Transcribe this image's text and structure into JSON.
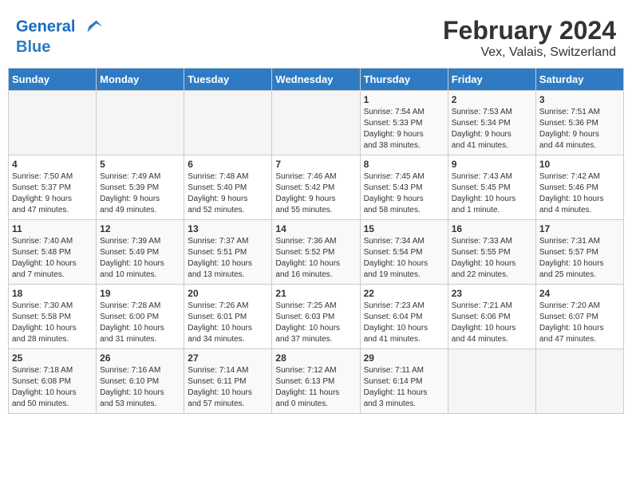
{
  "header": {
    "logo_general": "General",
    "logo_blue": "Blue",
    "title": "February 2024",
    "subtitle": "Vex, Valais, Switzerland"
  },
  "weekdays": [
    "Sunday",
    "Monday",
    "Tuesday",
    "Wednesday",
    "Thursday",
    "Friday",
    "Saturday"
  ],
  "weeks": [
    [
      {
        "day": null,
        "info": null
      },
      {
        "day": null,
        "info": null
      },
      {
        "day": null,
        "info": null
      },
      {
        "day": null,
        "info": null
      },
      {
        "day": "1",
        "info": "Sunrise: 7:54 AM\nSunset: 5:33 PM\nDaylight: 9 hours\nand 38 minutes."
      },
      {
        "day": "2",
        "info": "Sunrise: 7:53 AM\nSunset: 5:34 PM\nDaylight: 9 hours\nand 41 minutes."
      },
      {
        "day": "3",
        "info": "Sunrise: 7:51 AM\nSunset: 5:36 PM\nDaylight: 9 hours\nand 44 minutes."
      }
    ],
    [
      {
        "day": "4",
        "info": "Sunrise: 7:50 AM\nSunset: 5:37 PM\nDaylight: 9 hours\nand 47 minutes."
      },
      {
        "day": "5",
        "info": "Sunrise: 7:49 AM\nSunset: 5:39 PM\nDaylight: 9 hours\nand 49 minutes."
      },
      {
        "day": "6",
        "info": "Sunrise: 7:48 AM\nSunset: 5:40 PM\nDaylight: 9 hours\nand 52 minutes."
      },
      {
        "day": "7",
        "info": "Sunrise: 7:46 AM\nSunset: 5:42 PM\nDaylight: 9 hours\nand 55 minutes."
      },
      {
        "day": "8",
        "info": "Sunrise: 7:45 AM\nSunset: 5:43 PM\nDaylight: 9 hours\nand 58 minutes."
      },
      {
        "day": "9",
        "info": "Sunrise: 7:43 AM\nSunset: 5:45 PM\nDaylight: 10 hours\nand 1 minute."
      },
      {
        "day": "10",
        "info": "Sunrise: 7:42 AM\nSunset: 5:46 PM\nDaylight: 10 hours\nand 4 minutes."
      }
    ],
    [
      {
        "day": "11",
        "info": "Sunrise: 7:40 AM\nSunset: 5:48 PM\nDaylight: 10 hours\nand 7 minutes."
      },
      {
        "day": "12",
        "info": "Sunrise: 7:39 AM\nSunset: 5:49 PM\nDaylight: 10 hours\nand 10 minutes."
      },
      {
        "day": "13",
        "info": "Sunrise: 7:37 AM\nSunset: 5:51 PM\nDaylight: 10 hours\nand 13 minutes."
      },
      {
        "day": "14",
        "info": "Sunrise: 7:36 AM\nSunset: 5:52 PM\nDaylight: 10 hours\nand 16 minutes."
      },
      {
        "day": "15",
        "info": "Sunrise: 7:34 AM\nSunset: 5:54 PM\nDaylight: 10 hours\nand 19 minutes."
      },
      {
        "day": "16",
        "info": "Sunrise: 7:33 AM\nSunset: 5:55 PM\nDaylight: 10 hours\nand 22 minutes."
      },
      {
        "day": "17",
        "info": "Sunrise: 7:31 AM\nSunset: 5:57 PM\nDaylight: 10 hours\nand 25 minutes."
      }
    ],
    [
      {
        "day": "18",
        "info": "Sunrise: 7:30 AM\nSunset: 5:58 PM\nDaylight: 10 hours\nand 28 minutes."
      },
      {
        "day": "19",
        "info": "Sunrise: 7:28 AM\nSunset: 6:00 PM\nDaylight: 10 hours\nand 31 minutes."
      },
      {
        "day": "20",
        "info": "Sunrise: 7:26 AM\nSunset: 6:01 PM\nDaylight: 10 hours\nand 34 minutes."
      },
      {
        "day": "21",
        "info": "Sunrise: 7:25 AM\nSunset: 6:03 PM\nDaylight: 10 hours\nand 37 minutes."
      },
      {
        "day": "22",
        "info": "Sunrise: 7:23 AM\nSunset: 6:04 PM\nDaylight: 10 hours\nand 41 minutes."
      },
      {
        "day": "23",
        "info": "Sunrise: 7:21 AM\nSunset: 6:06 PM\nDaylight: 10 hours\nand 44 minutes."
      },
      {
        "day": "24",
        "info": "Sunrise: 7:20 AM\nSunset: 6:07 PM\nDaylight: 10 hours\nand 47 minutes."
      }
    ],
    [
      {
        "day": "25",
        "info": "Sunrise: 7:18 AM\nSunset: 6:08 PM\nDaylight: 10 hours\nand 50 minutes."
      },
      {
        "day": "26",
        "info": "Sunrise: 7:16 AM\nSunset: 6:10 PM\nDaylight: 10 hours\nand 53 minutes."
      },
      {
        "day": "27",
        "info": "Sunrise: 7:14 AM\nSunset: 6:11 PM\nDaylight: 10 hours\nand 57 minutes."
      },
      {
        "day": "28",
        "info": "Sunrise: 7:12 AM\nSunset: 6:13 PM\nDaylight: 11 hours\nand 0 minutes."
      },
      {
        "day": "29",
        "info": "Sunrise: 7:11 AM\nSunset: 6:14 PM\nDaylight: 11 hours\nand 3 minutes."
      },
      {
        "day": null,
        "info": null
      },
      {
        "day": null,
        "info": null
      }
    ]
  ]
}
